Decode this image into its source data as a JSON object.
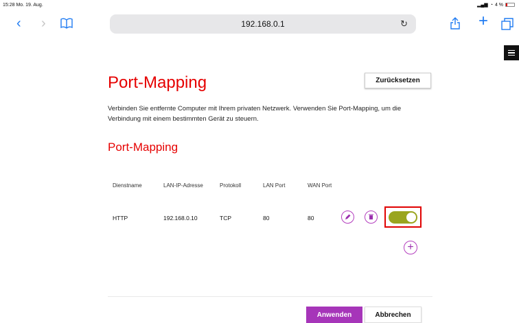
{
  "status": {
    "time": "15:28 Mo. 19. Aug.",
    "battery": "4 %"
  },
  "browser": {
    "url": "192.168.0.1"
  },
  "page": {
    "title": "Port-Mapping",
    "reset_label": "Zurücksetzen",
    "description": "Verbinden Sie entfernte Computer mit Ihrem privaten Netzwerk. Verwenden Sie Port-Mapping, um die Verbindung mit einem bestimmten Gerät zu steuern.",
    "section_title": "Port-Mapping"
  },
  "table": {
    "headers": [
      "Dienstname",
      "LAN-IP-Adresse",
      "Protokoll",
      "LAN Port",
      "WAN Port"
    ],
    "rows": [
      {
        "service": "HTTP",
        "ip": "192.168.0.10",
        "protocol": "TCP",
        "lan_port": "80",
        "wan_port": "80",
        "enabled": true
      }
    ]
  },
  "footer": {
    "apply_label": "Anwenden",
    "cancel_label": "Abbrechen"
  },
  "colors": {
    "brand_red": "#e60000",
    "accent_purple": "#a635b9",
    "toggle_on": "#9aa51f",
    "highlight": "#e00000"
  },
  "icons": [
    "back-icon",
    "forward-icon",
    "bookmarks-icon",
    "reload-icon",
    "share-icon",
    "new-tab-icon",
    "tabs-icon",
    "menu-icon",
    "edit-icon",
    "delete-icon",
    "add-icon"
  ]
}
